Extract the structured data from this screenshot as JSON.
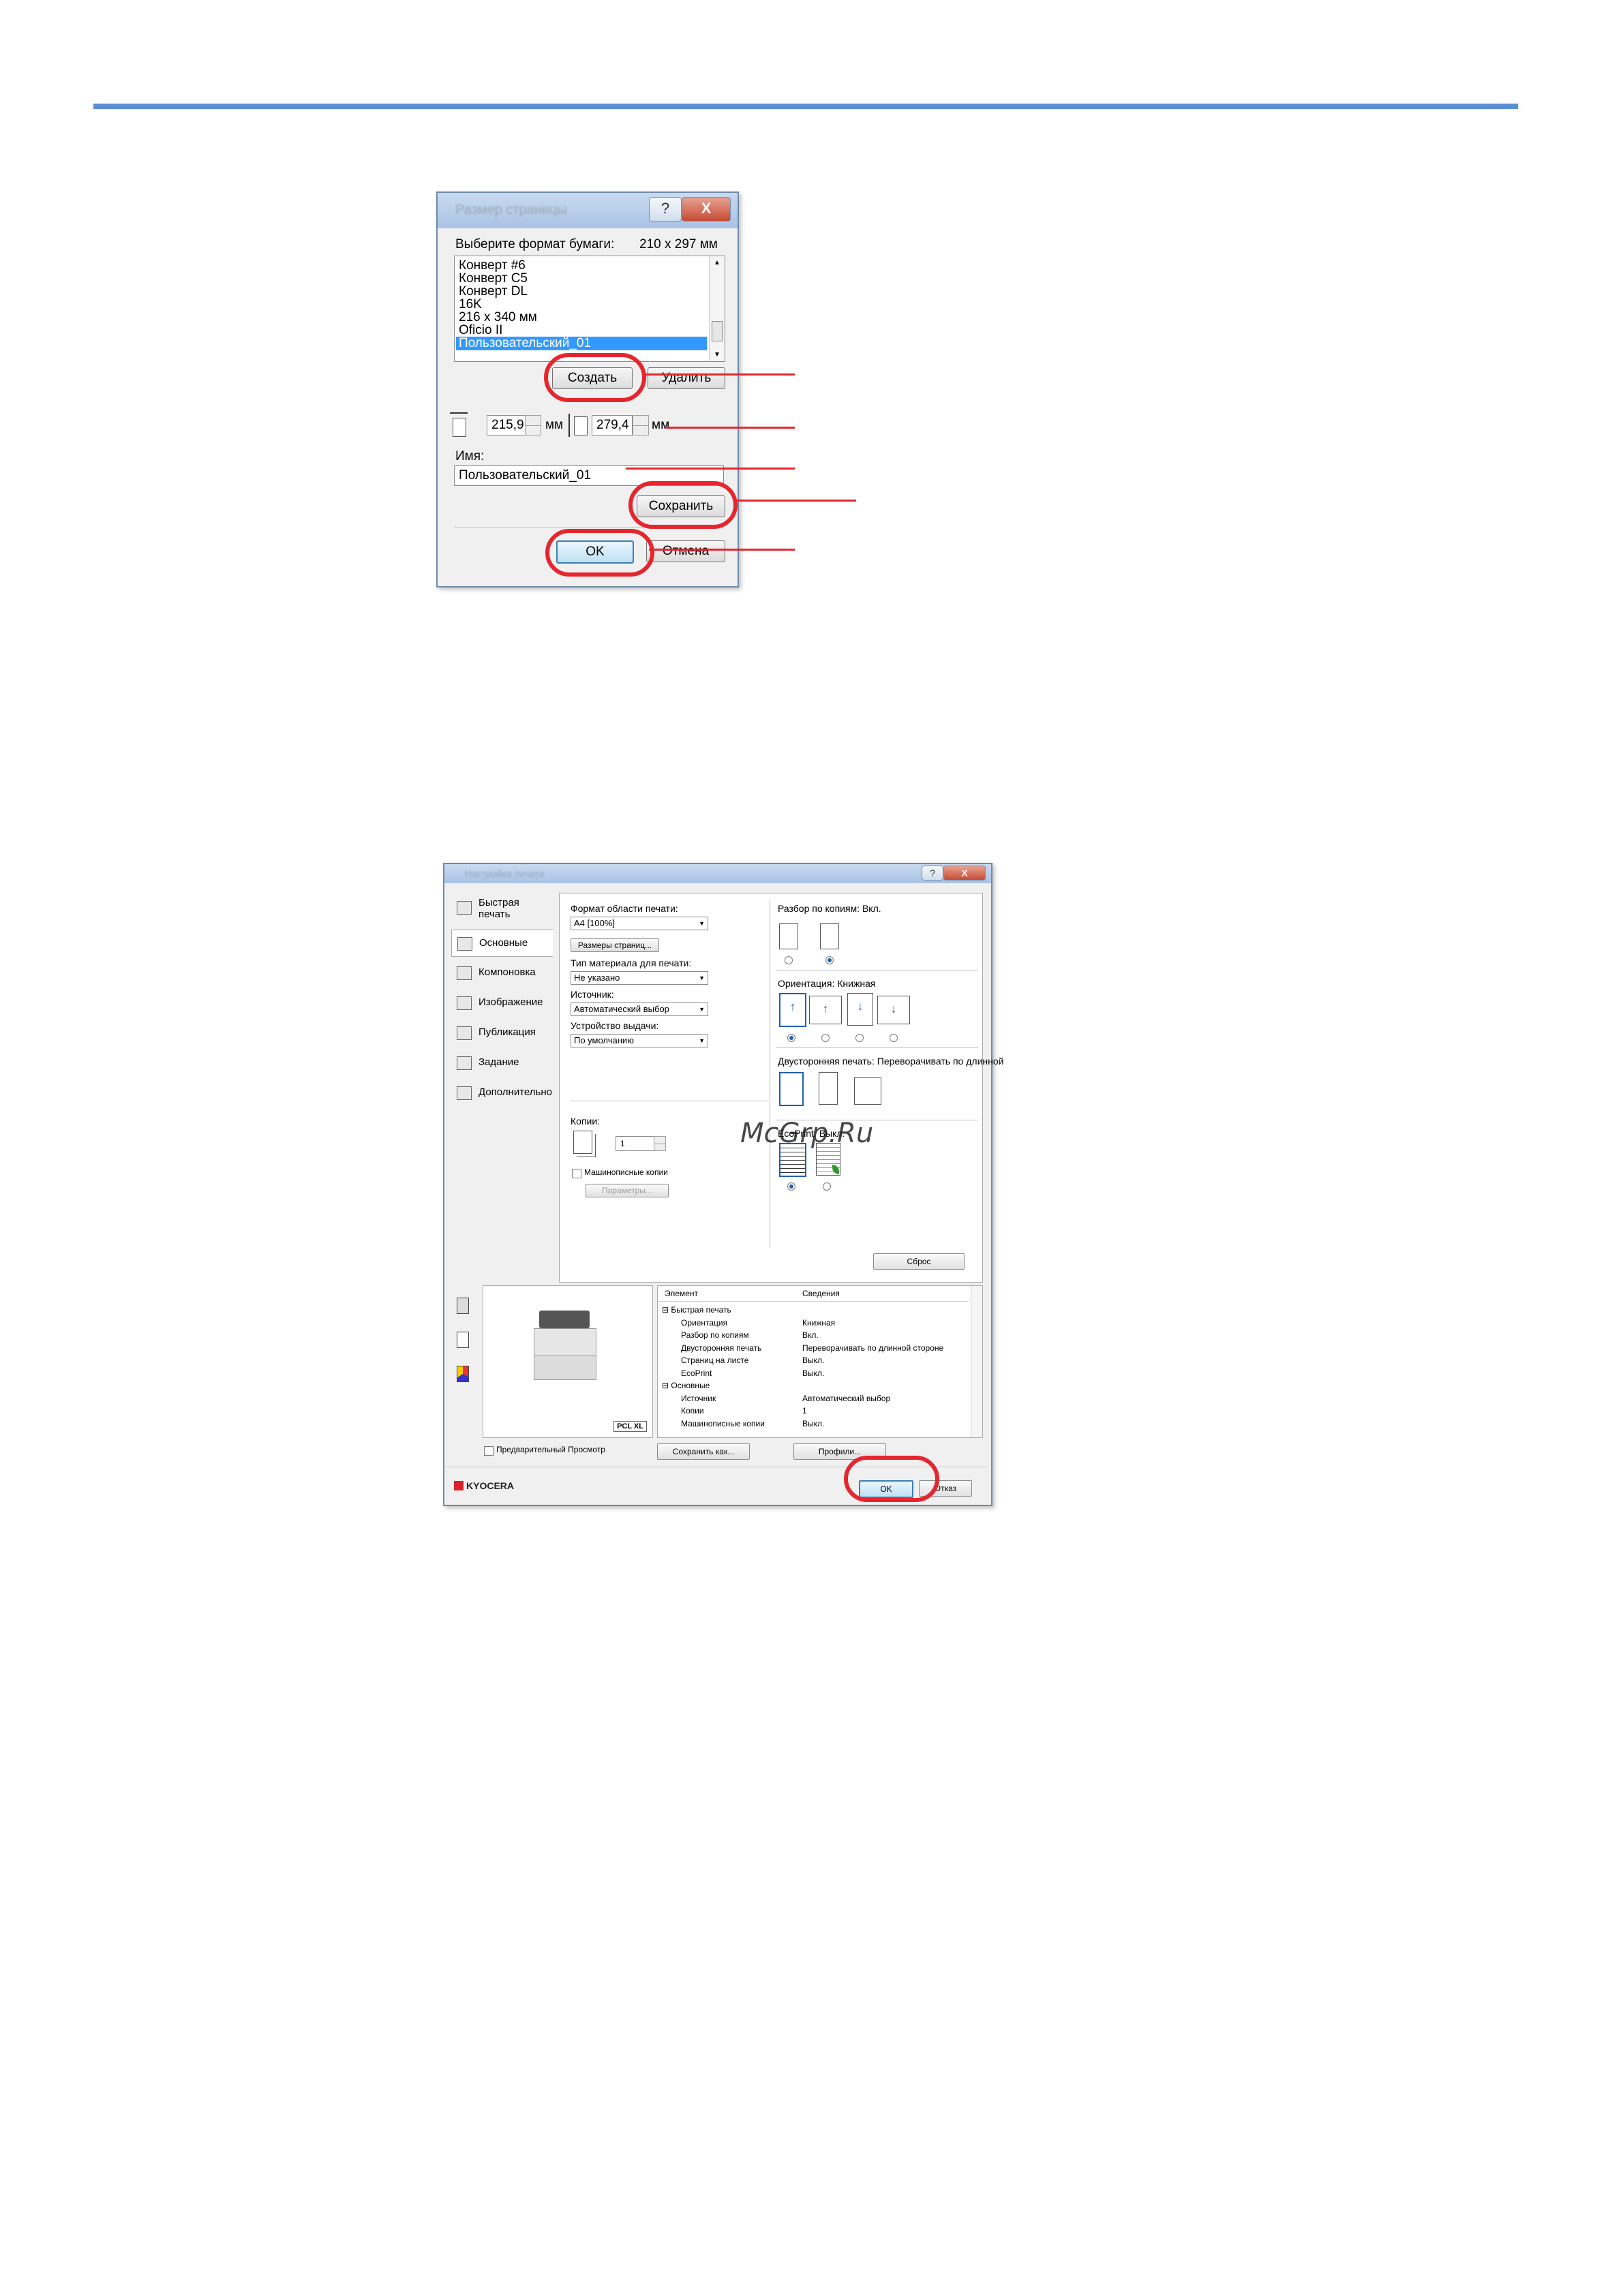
{
  "page_title_blurred": "Размер страницы",
  "dialog1": {
    "help_button": "?",
    "close_button": "X",
    "select_label": "Выберите формат бумаги:",
    "size_display": "210 x 297 мм",
    "list_items": [
      "Конверт #6",
      "Конверт C5",
      "Конверт DL",
      "16K",
      "216 x 340 мм",
      "Oficio II",
      "Пользовательский_01"
    ],
    "create_button": "Создать",
    "delete_button": "Удалить",
    "width_value": "215,9",
    "height_value": "279,4",
    "unit": "мм",
    "name_label": "Имя:",
    "name_value": "Пользовательский_01",
    "save_button": "Сохранить",
    "ok_button": "OK",
    "cancel_button": "Отмена"
  },
  "dialog2": {
    "title_blurred": "Настройка печати",
    "help_button": "?",
    "close_button": "X",
    "tabs": [
      {
        "label": "Быстрая печать"
      },
      {
        "label": "Основные"
      },
      {
        "label": "Компоновка"
      },
      {
        "label": "Изображение"
      },
      {
        "label": "Публикация"
      },
      {
        "label": "Задание"
      },
      {
        "label": "Дополнительно"
      }
    ],
    "print_size_label": "Формат области печати:",
    "print_size_value": "A4 [100%]",
    "page_sizes_button": "Размеры страниц...",
    "media_type_label": "Тип материала для печати:",
    "media_type_value": "Не указано",
    "source_label": "Источник:",
    "source_value": "Автоматический выбор",
    "output_label": "Устройство выдачи:",
    "output_value": "По умолчанию",
    "copies_label": "Копии:",
    "copies_value": "1",
    "mopy_label": "Машинописные копии",
    "params_button": "Параметры...",
    "collate_label": "Разбор по копиям:",
    "collate_value": "Вкл.",
    "orientation_label": "Ориентация:",
    "orientation_value": "Книжная",
    "duplex_label": "Двусторонняя печать:",
    "duplex_value": "Переворачивать по длинной",
    "ecoprint_label": "EcoPrint:",
    "ecoprint_value": "Выкл.",
    "reset_button": "Сброс",
    "summary_headers": [
      "Элемент",
      "Сведения"
    ],
    "summary_rows": [
      {
        "item": "⊟ Быстрая печать",
        "value": "",
        "indent": 0
      },
      {
        "item": "Ориентация",
        "value": "Книжная",
        "indent": 1
      },
      {
        "item": "Разбор по копиям",
        "value": "Вкл.",
        "indent": 1
      },
      {
        "item": "Двусторонняя печать",
        "value": "Переворачивать по длинной стороне",
        "indent": 1
      },
      {
        "item": "Страниц на листе",
        "value": "Выкл.",
        "indent": 1
      },
      {
        "item": "EcoPrint",
        "value": "Выкл.",
        "indent": 1
      },
      {
        "item": "⊟ Основные",
        "value": "",
        "indent": 0
      },
      {
        "item": "Источник",
        "value": "Автоматический выбор",
        "indent": 1
      },
      {
        "item": "Копии",
        "value": "1",
        "indent": 1
      },
      {
        "item": "Машинописные копии",
        "value": "Выкл.",
        "indent": 1
      }
    ],
    "pcl_badge": "PCL XL",
    "preview_label": "Предварительный Просмотр",
    "save_as_button": "Сохранить как...",
    "profiles_button": "Профили...",
    "brand": "KYOCERA",
    "ok_button": "OK",
    "cancel_button": "Отказ"
  },
  "watermark": "McGrp.Ru",
  "colors": {
    "accent_line": "#5a8fd6",
    "highlight_ring": "#e5262e",
    "selection": "#3399ff"
  }
}
